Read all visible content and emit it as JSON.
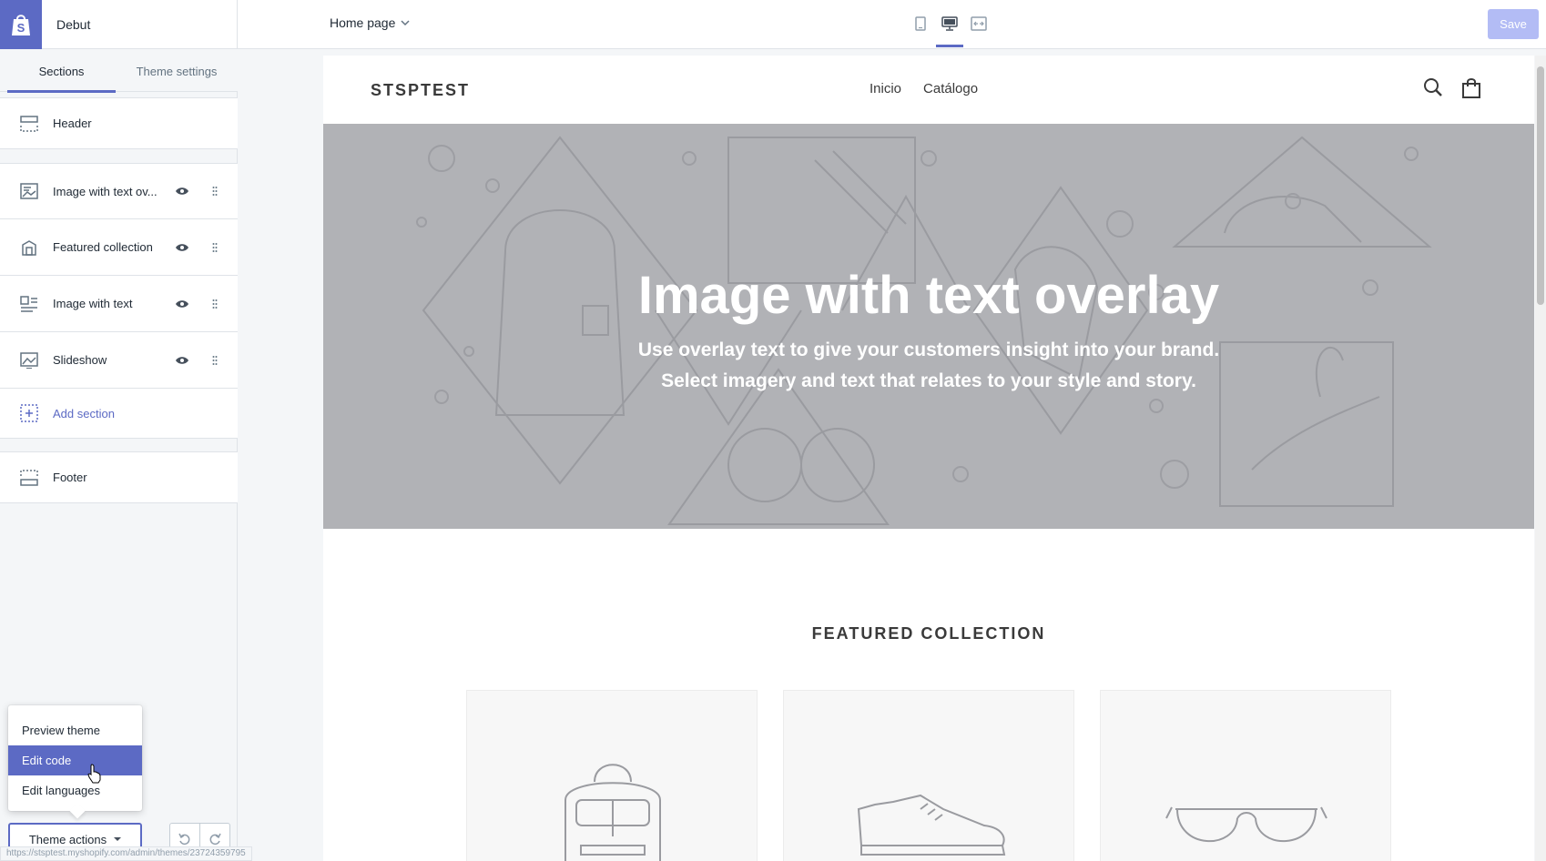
{
  "app": {
    "theme_name": "Debut",
    "page_selector": "Home page",
    "save_label": "Save",
    "accent_color": "#5c6ac4"
  },
  "devices": [
    {
      "icon": "mobile-icon",
      "active": false
    },
    {
      "icon": "desktop-icon",
      "active": true
    },
    {
      "icon": "fullscreen-icon",
      "active": false
    }
  ],
  "sidebar": {
    "tabs": [
      {
        "label": "Sections",
        "active": true
      },
      {
        "label": "Theme settings",
        "active": false
      }
    ],
    "header_section": {
      "label": "Header",
      "icon": "header-icon"
    },
    "sections": [
      {
        "label": "Image with text ov...",
        "icon": "image-overlay-icon"
      },
      {
        "label": "Featured collection",
        "icon": "collection-icon"
      },
      {
        "label": "Image with text",
        "icon": "image-text-icon"
      },
      {
        "label": "Slideshow",
        "icon": "slideshow-icon"
      }
    ],
    "add_section": {
      "label": "Add section",
      "icon": "add-section-icon"
    },
    "footer_section": {
      "label": "Footer",
      "icon": "footer-icon"
    },
    "theme_actions": {
      "label": "Theme actions",
      "menu": [
        {
          "label": "Preview theme",
          "highlighted": false
        },
        {
          "label": "Edit code",
          "highlighted": true
        },
        {
          "label": "Edit languages",
          "highlighted": false
        }
      ]
    }
  },
  "status_url": "https://stsptest.myshopify.com/admin/themes/23724359795",
  "preview": {
    "store_name": "STSPTEST",
    "nav": [
      "Inicio",
      "Catálogo"
    ],
    "hero": {
      "title": "Image with text overlay",
      "subtitle_line1": "Use overlay text to give your customers insight into your brand.",
      "subtitle_line2": "Select imagery and text that relates to your style and story."
    },
    "featured_title": "FEATURED COLLECTION",
    "products": [
      {
        "icon": "backpack-icon"
      },
      {
        "icon": "shoe-icon"
      },
      {
        "icon": "glasses-icon"
      }
    ]
  }
}
